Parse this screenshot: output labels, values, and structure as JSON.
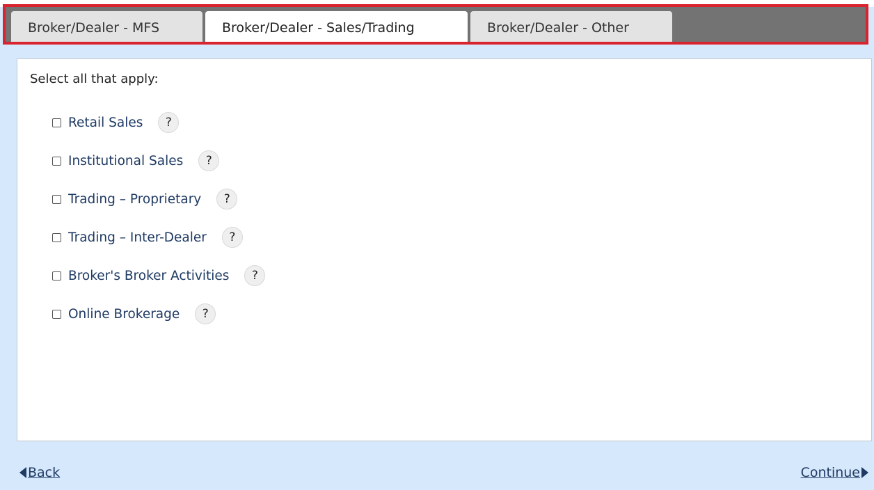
{
  "tabs": [
    {
      "label": "Broker/Dealer - MFS",
      "active": false
    },
    {
      "label": "Broker/Dealer - Sales/Trading",
      "active": true
    },
    {
      "label": "Broker/Dealer - Other",
      "active": false
    }
  ],
  "panel": {
    "prompt": "Select all that apply:",
    "options": [
      {
        "label": "Retail Sales",
        "checked": false,
        "help": "?"
      },
      {
        "label": "Institutional Sales",
        "checked": false,
        "help": "?"
      },
      {
        "label": "Trading – Proprietary",
        "checked": false,
        "help": "?"
      },
      {
        "label": "Trading – Inter-Dealer",
        "checked": false,
        "help": "?"
      },
      {
        "label": "Broker's Broker Activities",
        "checked": false,
        "help": "?"
      },
      {
        "label": "Online Brokerage",
        "checked": false,
        "help": "?"
      }
    ]
  },
  "nav": {
    "back_label": "Back",
    "continue_label": "Continue"
  },
  "colors": {
    "background": "#d6e8fb",
    "tabbar_bg": "#737373",
    "highlight_border": "#d9232e",
    "link": "#1f3a63"
  }
}
